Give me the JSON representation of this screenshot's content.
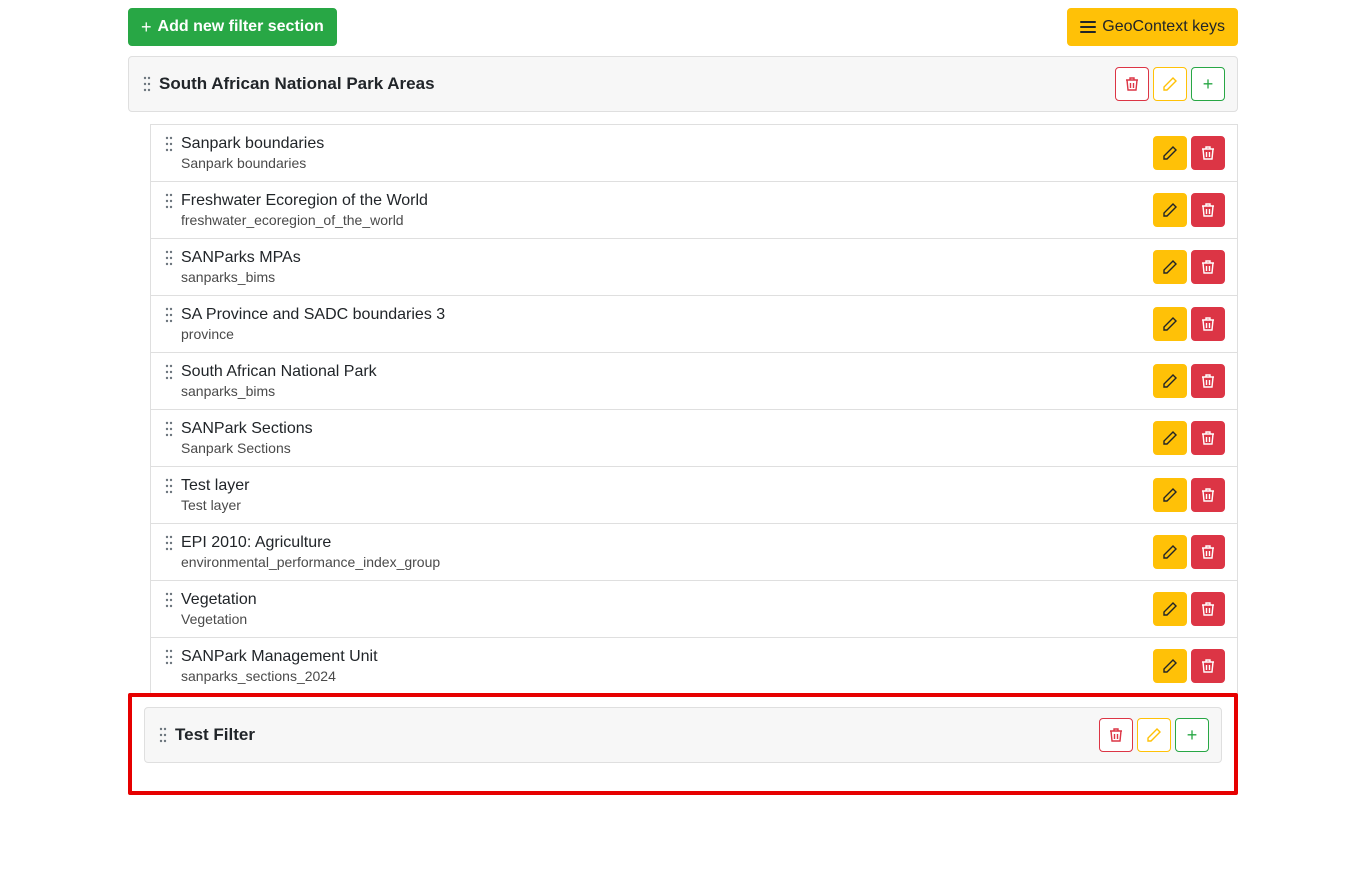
{
  "toolbar": {
    "add_filter_label": "Add new filter section",
    "geocontext_label": "GeoContext keys"
  },
  "sections": [
    {
      "title": "South African National Park Areas",
      "items": [
        {
          "title": "Sanpark boundaries",
          "subtitle": "Sanpark boundaries"
        },
        {
          "title": "Freshwater Ecoregion of the World",
          "subtitle": "freshwater_ecoregion_of_the_world"
        },
        {
          "title": "SANParks MPAs",
          "subtitle": "sanparks_bims"
        },
        {
          "title": "SA Province and SADC boundaries 3",
          "subtitle": "province"
        },
        {
          "title": "South African National Park",
          "subtitle": "sanparks_bims"
        },
        {
          "title": "SANPark Sections",
          "subtitle": "Sanpark Sections"
        },
        {
          "title": "Test layer",
          "subtitle": "Test layer"
        },
        {
          "title": "EPI 2010: Agriculture",
          "subtitle": "environmental_performance_index_group"
        },
        {
          "title": "Vegetation",
          "subtitle": "Vegetation"
        },
        {
          "title": "SANPark Management Unit",
          "subtitle": "sanparks_sections_2024"
        }
      ]
    },
    {
      "title": "Test Filter",
      "items": []
    }
  ]
}
